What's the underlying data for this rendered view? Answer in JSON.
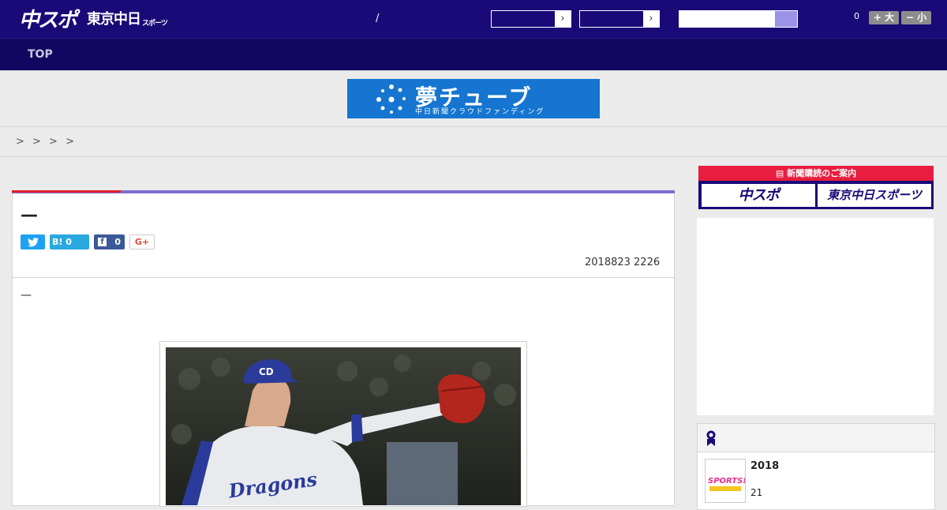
{
  "header": {
    "logo_chuspo": "中スポ",
    "logo_tokyo": "東京中日",
    "logo_tokyo_sub": "スポーツ",
    "separator": "/",
    "select_arrow": "›",
    "count": "0",
    "font_large": "+ 大",
    "font_small": "− 小"
  },
  "nav": {
    "top": "TOP"
  },
  "banner": {
    "title": "夢チューブ",
    "subtitle": "中日新聞クラウドファンディング"
  },
  "breadcrumb": "> > >  >",
  "article": {
    "title": "—",
    "share": {
      "twitter": "",
      "hatena": "B! 0",
      "facebook_count": "0",
      "gplus": "G+"
    },
    "date": "2018823 2226",
    "lead": "—"
  },
  "sidebar": {
    "subscription_head": "新聞購読のご案内",
    "sub_chuspo": "中スポ",
    "sub_tokyo": "東京中日スポーツ",
    "ranking": {
      "title": "2018",
      "sub": "21",
      "thumb_label": "SPORTS!!"
    }
  },
  "colors": {
    "header": "#1a0a78",
    "nav": "#120760",
    "accent_red": "#e0202f",
    "banner_blue": "#1575d0"
  }
}
